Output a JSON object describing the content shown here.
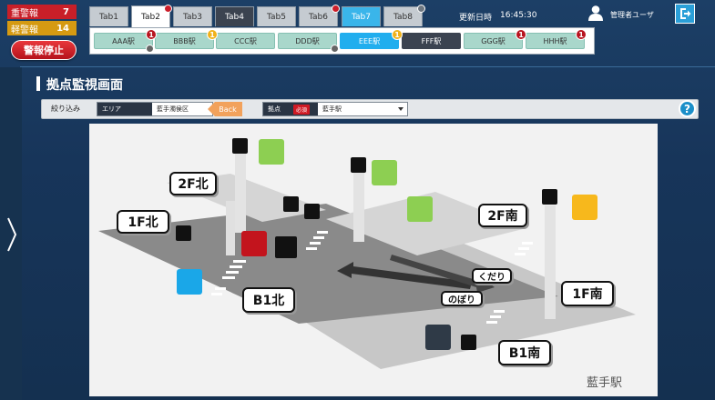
{
  "alarms": {
    "heavy": {
      "label": "重警報",
      "count": "7"
    },
    "light": {
      "label": "軽警報",
      "count": "14"
    },
    "stop_label": "警報停止"
  },
  "tabs": [
    {
      "label": "Tab1"
    },
    {
      "label": "Tab2"
    },
    {
      "label": "Tab3"
    },
    {
      "label": "Tab4"
    },
    {
      "label": "Tab5"
    },
    {
      "label": "Tab6"
    },
    {
      "label": "Tab7"
    },
    {
      "label": "Tab8"
    }
  ],
  "stations": [
    {
      "label": "AAA駅",
      "badge": "1"
    },
    {
      "label": "BBB駅",
      "badge": "1"
    },
    {
      "label": "CCC駅",
      "badge": ""
    },
    {
      "label": "DDD駅",
      "badge": ""
    },
    {
      "label": "EEE駅",
      "badge": "1"
    },
    {
      "label": "FFF駅",
      "badge": ""
    },
    {
      "label": "GGG駅",
      "badge": "1"
    },
    {
      "label": "HHH駅",
      "badge": "1"
    }
  ],
  "header": {
    "update_label": "更新日時",
    "update_time": "16:45:30",
    "user_name": "管理者ユーザ"
  },
  "page": {
    "title": "拠点監視画面"
  },
  "filter": {
    "label": "絞り込み",
    "area_head": "エリア",
    "area_value": "藍手濁侯区",
    "back_label": "Back",
    "base_head": "拠点",
    "required": "必須",
    "base_value": "藍手駅"
  },
  "map": {
    "floors": {
      "f2_north": "2F北",
      "f1_north": "1F北",
      "b1_north": "B1北",
      "f2_south": "2F南",
      "f1_south": "1F南",
      "b1_south": "B1南"
    },
    "down_label": "くだり",
    "up_label": "のぼり",
    "station_name": "藍手駅"
  },
  "colors": {
    "green": "#8dcf52",
    "yellow": "#f7b81c",
    "red": "#c3141d",
    "blue": "#1aa7e8",
    "dark": "#2f3a47"
  }
}
